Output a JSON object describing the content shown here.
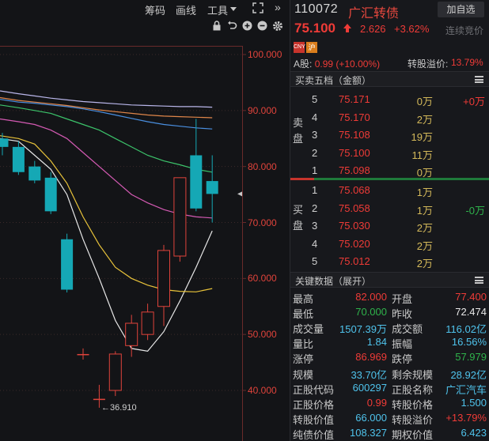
{
  "toolbar": {
    "items": [
      "筹码",
      "画线",
      "工具"
    ],
    "expand_icon": "expand-icon",
    "collapse_icon": "double-chevron-right-icon",
    "sub_icons": [
      "lock-icon",
      "undo-icon",
      "zoom-in-icon",
      "zoom-out-icon",
      "settings-icon"
    ]
  },
  "chart": {
    "y_ticks": [
      "100.000",
      "90.000",
      "80.000",
      "70.000",
      "60.000",
      "50.000",
      "40.000"
    ],
    "min_label": "←36.910",
    "colors": {
      "up": "#e0433b",
      "down": "#15a8b5",
      "axis_text": "#e0433b"
    }
  },
  "chart_data": {
    "type": "candlestick",
    "ylim": [
      34,
      103
    ],
    "candles": [
      {
        "open": 85.0,
        "close": 83.5,
        "high": 86.0,
        "low": 82.0
      },
      {
        "open": 83.5,
        "close": 79.0,
        "high": 84.5,
        "low": 78.5
      },
      {
        "open": 80.0,
        "close": 77.5,
        "high": 81.0,
        "low": 77.0
      },
      {
        "open": 78.0,
        "close": 72.0,
        "high": 79.0,
        "low": 71.5
      },
      {
        "open": 67.0,
        "close": 58.0,
        "high": 68.0,
        "low": 57.5
      },
      {
        "open": 46.5,
        "close": 46.5,
        "high": 47.5,
        "low": 45.5
      },
      {
        "open": 38.5,
        "close": 38.5,
        "high": 41.0,
        "low": 36.91
      },
      {
        "open": 40.0,
        "close": 46.5,
        "high": 47.0,
        "low": 39.0
      },
      {
        "open": 48.0,
        "close": 52.0,
        "high": 53.5,
        "low": 46.0
      },
      {
        "open": 50.0,
        "close": 54.0,
        "high": 55.5,
        "low": 49.0
      },
      {
        "open": 55.0,
        "close": 65.0,
        "high": 66.0,
        "low": 51.5
      },
      {
        "open": 64.0,
        "close": 78.0,
        "high": 78.0,
        "low": 63.0
      },
      {
        "open": 82.0,
        "close": 72.5,
        "high": 88.5,
        "low": 72.0
      },
      {
        "open": 77.4,
        "close": 75.1,
        "high": 82.0,
        "low": 70.0
      }
    ],
    "ma_lines": [
      {
        "color": "#e8e8e8",
        "values": [
          null,
          84.5,
          82.0,
          79.5,
          75.0,
          67.0,
          60.0,
          52.5,
          47.5,
          47.0,
          50.5,
          56.0,
          62.0,
          68.5
        ]
      },
      {
        "color": "#e8c33a",
        "values": [
          null,
          85.0,
          84.0,
          81.0,
          77.0,
          71.0,
          66.0,
          62.0,
          60.0,
          58.8,
          58.0,
          57.7,
          57.6,
          58.2
        ]
      },
      {
        "color": "#d45ab3",
        "values": [
          null,
          88.0,
          87.5,
          86.5,
          85.0,
          82.5,
          80.0,
          77.5,
          75.0,
          73.5,
          72.3,
          71.5,
          71.0,
          70.8
        ]
      },
      {
        "color": "#3cc46b",
        "values": [
          null,
          90.5,
          90.0,
          89.5,
          88.5,
          87.5,
          86.5,
          85.0,
          83.5,
          82.0,
          81.0,
          80.3,
          79.5,
          79.0
        ]
      },
      {
        "color": "#4a8fe0",
        "values": [
          null,
          91.5,
          91.3,
          91.0,
          90.7,
          90.3,
          89.8,
          89.2,
          88.6,
          88.0,
          87.5,
          87.2,
          86.9,
          86.7
        ]
      },
      {
        "color": "#e0864a",
        "values": [
          null,
          91.8,
          91.5,
          91.2,
          90.9,
          90.5,
          90.1,
          89.8,
          89.5,
          89.2,
          89.0,
          88.9,
          88.8,
          88.7
        ]
      },
      {
        "color": "#b9b6ea",
        "values": [
          null,
          93.0,
          92.6,
          92.2,
          91.9,
          91.6,
          91.4,
          91.2,
          91.0,
          90.9,
          90.8,
          90.7,
          90.7,
          90.6
        ]
      }
    ]
  },
  "header": {
    "code": "110072",
    "name": "广汇转债",
    "add_button": "加自选",
    "price": "75.100",
    "change": "2.626",
    "change_pct": "+3.62%",
    "auction": "连续竞价",
    "badges": [
      "CNY",
      "沪"
    ],
    "a_share_label": "A股:",
    "a_share_value": "0.99 (+10.00%)",
    "premium_label": "转股溢价:",
    "premium_value": "13.79%"
  },
  "orderbook": {
    "title": "买卖五档（金额）",
    "sell_label": "卖盘",
    "buy_label": "买盘",
    "sells": [
      {
        "level": "5",
        "price": "75.171",
        "vol": "0万",
        "delta": "+0万",
        "delta_color": "red"
      },
      {
        "level": "4",
        "price": "75.170",
        "vol": "2万",
        "delta": "",
        "delta_color": "red"
      },
      {
        "level": "3",
        "price": "75.108",
        "vol": "19万",
        "delta": "",
        "delta_color": "red"
      },
      {
        "level": "2",
        "price": "75.100",
        "vol": "11万",
        "delta": "",
        "delta_color": "red"
      },
      {
        "level": "1",
        "price": "75.098",
        "vol": "0万",
        "delta": "",
        "delta_color": "red"
      }
    ],
    "buys": [
      {
        "level": "1",
        "price": "75.068",
        "vol": "1万",
        "delta": "",
        "delta_color": "green"
      },
      {
        "level": "2",
        "price": "75.058",
        "vol": "1万",
        "delta": "-0万",
        "delta_color": "green"
      },
      {
        "level": "3",
        "price": "75.030",
        "vol": "2万",
        "delta": "",
        "delta_color": "green"
      },
      {
        "level": "4",
        "price": "75.020",
        "vol": "2万",
        "delta": "",
        "delta_color": "green"
      },
      {
        "level": "5",
        "price": "75.012",
        "vol": "2万",
        "delta": "",
        "delta_color": "green"
      }
    ]
  },
  "key_data": {
    "title": "关键数据（展开）",
    "rows": [
      {
        "l1": "最高",
        "v1": "82.000",
        "c1": "red",
        "l2": "开盘",
        "v2": "77.400",
        "c2": "red"
      },
      {
        "l1": "最低",
        "v1": "70.000",
        "c1": "green",
        "l2": "昨收",
        "v2": "72.474",
        "c2": "white"
      },
      {
        "l1": "成交量",
        "v1": "1507.39万",
        "c1": "cyan",
        "l2": "成交额",
        "v2": "116.02亿",
        "c2": "cyan"
      },
      {
        "l1": "量比",
        "v1": "1.84",
        "c1": "cyan",
        "l2": "振幅",
        "v2": "16.56%",
        "c2": "cyan"
      },
      {
        "l1": "涨停",
        "v1": "86.969",
        "c1": "red",
        "l2": "跌停",
        "v2": "57.979",
        "c2": "green"
      },
      {
        "l1": "规模",
        "v1": "33.70亿",
        "c1": "cyan",
        "l2": "剩余规模",
        "v2": "28.92亿",
        "c2": "cyan"
      },
      {
        "l1": "正股代码",
        "v1": "600297",
        "c1": "cyan",
        "l2": "正股名称",
        "v2": "广汇汽车",
        "c2": "cyan"
      },
      {
        "l1": "正股价格",
        "v1": "0.99",
        "c1": "red",
        "l2": "转股价格",
        "v2": "1.500",
        "c2": "cyan"
      },
      {
        "l1": "转股价值",
        "v1": "66.000",
        "c1": "cyan",
        "l2": "转股溢价",
        "v2": "+13.79%",
        "c2": "red"
      },
      {
        "l1": "纯债价值",
        "v1": "108.327",
        "c1": "cyan",
        "l2": "期权价值",
        "v2": "6.423",
        "c2": "cyan"
      }
    ]
  }
}
